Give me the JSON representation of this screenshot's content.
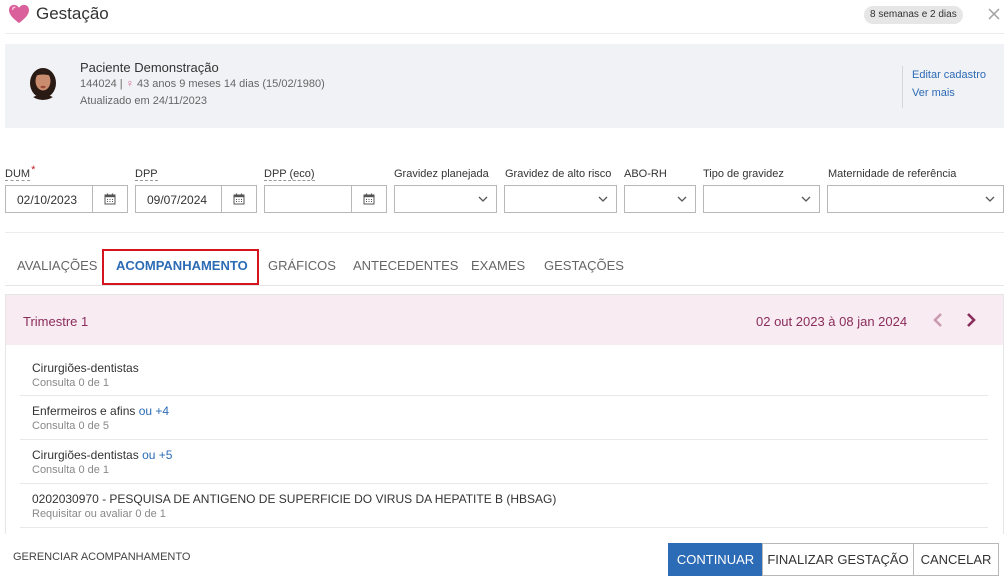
{
  "header": {
    "title": "Gestação",
    "weeks_badge": "8 semanas e 2 dias",
    "close_icon": "close-icon",
    "heart_color": "#d9609a"
  },
  "patient": {
    "name": "Paciente Demonstração",
    "id": "144024",
    "separator": "|",
    "sex_icon": "female-icon",
    "age": "43 anos 9 meses 14 dias (15/02/1980)",
    "updated": "Atualizado em 24/11/2023",
    "links": {
      "edit": "Editar cadastro",
      "more": "Ver mais"
    }
  },
  "fields": {
    "dum": {
      "label": "DUM",
      "required_mark": "*",
      "value": "02/10/2023"
    },
    "dpp": {
      "label": "DPP",
      "value": "09/07/2024"
    },
    "dpp_eco": {
      "label": "DPP (eco)",
      "value": ""
    },
    "gravidez_planejada": {
      "label": "Gravidez planejada",
      "value": ""
    },
    "alto_risco": {
      "label": "Gravidez de alto risco",
      "value": ""
    },
    "abo_rh": {
      "label": "ABO-RH",
      "value": ""
    },
    "tipo_gravidez": {
      "label": "Tipo de gravidez",
      "value": ""
    },
    "maternidade": {
      "label": "Maternidade de referência",
      "value": ""
    }
  },
  "tabs": [
    {
      "label": "AVALIAÇÕES",
      "active": false
    },
    {
      "label": "ACOMPANHAMENTO",
      "active": true
    },
    {
      "label": "GRÁFICOS",
      "active": false
    },
    {
      "label": "ANTECEDENTES",
      "active": false
    },
    {
      "label": "EXAMES",
      "active": false
    },
    {
      "label": "GESTAÇÕES",
      "active": false
    }
  ],
  "trimester": {
    "title": "Trimestre 1",
    "range": "02 out 2023 à 08 jan 2024",
    "color": "#8a2d5c",
    "items": [
      {
        "title": "Cirurgiões-dentistas",
        "more": "",
        "sub": "Consulta 0 de 1"
      },
      {
        "title": "Enfermeiros e afins",
        "more": "ou +4",
        "sub": "Consulta 0 de 5"
      },
      {
        "title": "Cirurgiões-dentistas",
        "more": "ou +5",
        "sub": "Consulta 0 de 1"
      },
      {
        "title": "0202030970 - PESQUISA DE ANTIGENO DE SUPERFICIE DO VIRUS DA HEPATITE B (HBSAG)",
        "more": "",
        "sub": "Requisitar ou avaliar 0 de 1"
      }
    ]
  },
  "footer": {
    "manage": "GERENCIAR ACOMPANHAMENTO",
    "continue": "CONTINUAR",
    "finish": "FINALIZAR GESTAÇÃO",
    "cancel": "CANCELAR",
    "primary_color": "#2c6bb5"
  }
}
